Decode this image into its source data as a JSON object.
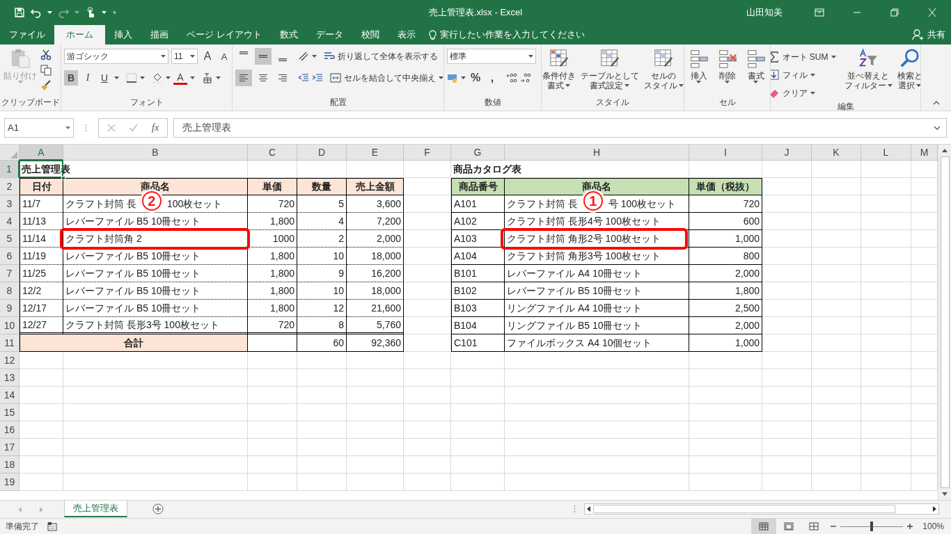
{
  "window": {
    "title": "売上管理表.xlsx - Excel",
    "user": "山田知美"
  },
  "ribbon_tabs": [
    {
      "label": "ファイル",
      "selected": false
    },
    {
      "label": "ホーム",
      "selected": true
    },
    {
      "label": "挿入",
      "selected": false
    },
    {
      "label": "描画",
      "selected": false
    },
    {
      "label": "ページ レイアウト",
      "selected": false
    },
    {
      "label": "数式",
      "selected": false
    },
    {
      "label": "データ",
      "selected": false
    },
    {
      "label": "校閲",
      "selected": false
    },
    {
      "label": "表示",
      "selected": false
    }
  ],
  "tell_me": "実行したい作業を入力してください",
  "share": "共有",
  "ribbon": {
    "clipboard": {
      "paste": "貼り付け",
      "label": "クリップボード"
    },
    "font": {
      "name": "游ゴシック",
      "size": "11",
      "grow": "A",
      "shrink": "A",
      "bold": {
        "label": "B",
        "selected": true
      },
      "italic": "I",
      "underline": "U",
      "color_letter": "A",
      "label": "フォント"
    },
    "alignment": {
      "valign": [
        {
          "selected": false
        },
        {
          "selected": true
        },
        {
          "selected": false
        }
      ],
      "halign": [
        {
          "selected": true
        },
        {
          "selected": false
        },
        {
          "selected": false
        }
      ],
      "wrap": "折り返して全体を表示する",
      "merge": "セルを結合して中央揃え",
      "label": "配置"
    },
    "number": {
      "format": "標準",
      "percent": "%",
      "comma": ",",
      "label": "数値"
    },
    "styles": {
      "buttons": [
        {
          "line1": "条件付き",
          "line2": "書式"
        },
        {
          "line1": "テーブルとして",
          "line2": "書式設定"
        },
        {
          "line1": "セルの",
          "line2": "スタイル"
        }
      ],
      "label": "スタイル"
    },
    "cells": {
      "buttons": [
        "挿入",
        "削除",
        "書式"
      ],
      "label": "セル"
    },
    "editing": {
      "autosum": "オート SUM",
      "fill": "フィル",
      "clear": "クリア",
      "sort": {
        "line1": "並べ替えと",
        "line2": "フィルター"
      },
      "find": {
        "line1": "検索と",
        "line2": "選択"
      },
      "label": "編集"
    }
  },
  "formula_bar": {
    "name_box": "A1",
    "fx": "fx",
    "content": "売上管理表"
  },
  "sheet": {
    "columns": [
      {
        "label": "A",
        "selected": true
      },
      {
        "label": "B",
        "selected": false
      },
      {
        "label": "C",
        "selected": false
      },
      {
        "label": "D",
        "selected": false
      },
      {
        "label": "E",
        "selected": false
      },
      {
        "label": "F",
        "selected": false
      },
      {
        "label": "G",
        "selected": false
      },
      {
        "label": "H",
        "selected": false
      },
      {
        "label": "I",
        "selected": false
      },
      {
        "label": "J",
        "selected": false
      },
      {
        "label": "K",
        "selected": false
      },
      {
        "label": "L",
        "selected": false
      },
      {
        "label": "M",
        "selected": false
      }
    ],
    "rows": [
      {
        "label": "1",
        "selected": true
      },
      {
        "label": "2",
        "selected": false
      },
      {
        "label": "3",
        "selected": false
      },
      {
        "label": "4",
        "selected": false
      },
      {
        "label": "5",
        "selected": false
      },
      {
        "label": "6",
        "selected": false
      },
      {
        "label": "7",
        "selected": false
      },
      {
        "label": "8",
        "selected": false
      },
      {
        "label": "9",
        "selected": false
      },
      {
        "label": "10",
        "selected": false
      },
      {
        "label": "11",
        "selected": false
      },
      {
        "label": "12",
        "selected": false
      },
      {
        "label": "13",
        "selected": false
      },
      {
        "label": "14",
        "selected": false
      },
      {
        "label": "15",
        "selected": false
      },
      {
        "label": "16",
        "selected": false
      },
      {
        "label": "17",
        "selected": false
      },
      {
        "label": "18",
        "selected": false
      },
      {
        "label": "19",
        "selected": false
      }
    ],
    "sales": {
      "title": "売上管理表",
      "headers": [
        "日付",
        "商品名",
        "単価",
        "数量",
        "売上金額"
      ],
      "rows": [
        {
          "date": "11/7",
          "name_parts": [
            "クラフト封筒 長",
            "100枚セット"
          ],
          "marker": "2",
          "price": "720",
          "qty": "5",
          "amount": "3,600",
          "highlighted": false
        },
        {
          "date": "11/13",
          "name": "レバーファイル B5 10冊セット",
          "price": "1,800",
          "qty": "4",
          "amount": "7,200",
          "highlighted": false
        },
        {
          "date": "11/14",
          "name": "クラフト封筒角 2",
          "price": "1000",
          "qty": "2",
          "amount": "2,000",
          "highlighted": true
        },
        {
          "date": "11/19",
          "name": "レバーファイル B5 10冊セット",
          "price": "1,800",
          "qty": "10",
          "amount": "18,000",
          "highlighted": false
        },
        {
          "date": "11/25",
          "name": "レバーファイル B5 10冊セット",
          "price": "1,800",
          "qty": "9",
          "amount": "16,200",
          "highlighted": false
        },
        {
          "date": "12/2",
          "name": "レバーファイル B5 10冊セット",
          "price": "1,800",
          "qty": "10",
          "amount": "18,000",
          "highlighted": false
        },
        {
          "date": "12/17",
          "name": "レバーファイル B5 10冊セット",
          "price": "1,800",
          "qty": "12",
          "amount": "21,600",
          "highlighted": false
        },
        {
          "date": "12/27",
          "name": "クラフト封筒 長形3号 100枚セット",
          "price": "720",
          "qty": "8",
          "amount": "5,760",
          "highlighted": false
        }
      ],
      "total": {
        "label": "合計",
        "qty": "60",
        "amount": "92,360"
      }
    },
    "catalog": {
      "title": "商品カタログ表",
      "headers": [
        "商品番号",
        "商品名",
        "単価（税抜）"
      ],
      "rows": [
        {
          "code": "A101",
          "name_parts": [
            "クラフト封筒 長",
            "号 100枚セット"
          ],
          "marker": "1",
          "price": "720",
          "highlighted": false
        },
        {
          "code": "A102",
          "name": "クラフト封筒 長形4号 100枚セット",
          "price": "600",
          "highlighted": false
        },
        {
          "code": "A103",
          "name": "クラフト封筒 角形2号 100枚セット",
          "price": "1,000",
          "highlighted": true
        },
        {
          "code": "A104",
          "name": "クラフト封筒 角形3号 100枚セット",
          "price": "800",
          "highlighted": false
        },
        {
          "code": "B101",
          "name": "レバーファイル A4 10冊セット",
          "price": "2,000",
          "highlighted": false
        },
        {
          "code": "B102",
          "name": "レバーファイル B5 10冊セット",
          "price": "1,800",
          "highlighted": false
        },
        {
          "code": "B103",
          "name": "リングファイル A4 10冊セット",
          "price": "2,500",
          "highlighted": false
        },
        {
          "code": "B104",
          "name": "リングファイル B5 10冊セット",
          "price": "2,000",
          "highlighted": false
        },
        {
          "code": "C101",
          "name": "ファイルボックス A4 10個セット",
          "price": "1,000",
          "highlighted": false
        }
      ]
    }
  },
  "sheet_tabs": [
    {
      "label": "売上管理表",
      "selected": true
    }
  ],
  "status_bar": {
    "text": "準備完了",
    "views": [
      {
        "selected": true
      },
      {
        "selected": false
      },
      {
        "selected": false
      }
    ],
    "zoom_slider": {
      "level": 0.5
    },
    "zoom": "100%"
  }
}
